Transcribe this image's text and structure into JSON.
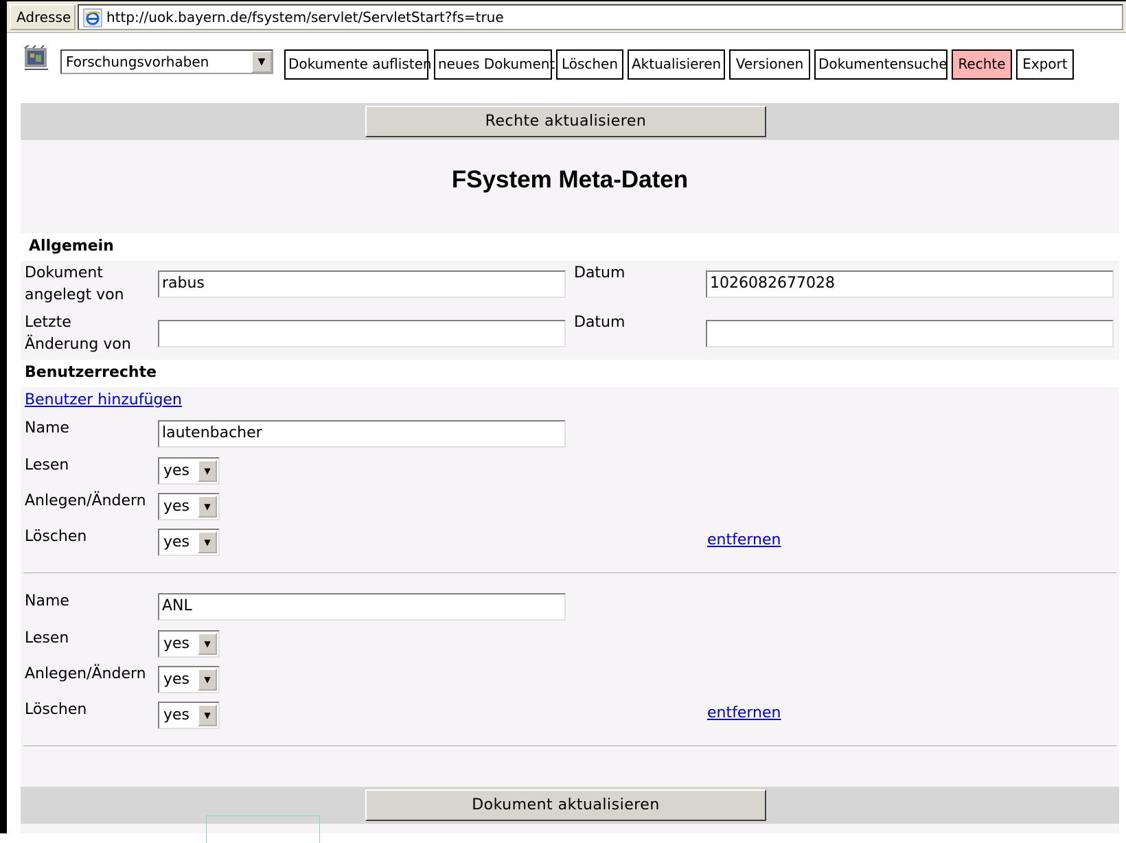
{
  "addressbar": {
    "label": "Adresse",
    "url": "http://uok.bayern.de/fsystem/servlet/ServletStart?fs=true"
  },
  "toolbar": {
    "doctype_selected": "Forschungsvorhaben",
    "buttons": [
      {
        "label": "Dokumente auflisten"
      },
      {
        "label": "neues Dokument"
      },
      {
        "label": "Löschen"
      },
      {
        "label": "Aktualisieren"
      },
      {
        "label": "Versionen"
      },
      {
        "label": "Dokumentensuche"
      },
      {
        "label": "Rechte",
        "color": "#ffb4b4"
      },
      {
        "label": "Export"
      }
    ]
  },
  "top_action": {
    "label": "Rechte aktualisieren"
  },
  "page_title": "FSystem Meta-Daten",
  "allgemein": {
    "heading": "Allgemein",
    "created_by_label_1": "Dokument",
    "created_by_label_2": "angelegt von",
    "created_by_value": "rabus",
    "date_label": "Datum",
    "created_date_value": "1026082677028",
    "modified_by_label_1": "Letzte",
    "modified_by_label_2": "Änderung von",
    "modified_by_value": "",
    "modified_date_label": "Datum",
    "modified_date_value": ""
  },
  "rights": {
    "heading": "Benutzerrechte",
    "add_user_link": "Benutzer hinzufügen",
    "entries": [
      {
        "name_label": "Name",
        "name_value": "lautenbacher",
        "read_label": "Lesen",
        "read_value": "yes",
        "edit_label": "Anlegen/Ändern",
        "edit_value": "yes",
        "delete_label": "Löschen",
        "delete_value": "yes",
        "remove_link": "entfernen"
      },
      {
        "name_label": "Name",
        "name_value": "ANL",
        "read_label": "Lesen",
        "read_value": "yes",
        "edit_label": "Anlegen/Ändern",
        "edit_value": "yes",
        "delete_label": "Löschen",
        "delete_value": "yes",
        "remove_link": "entfernen"
      }
    ]
  },
  "bottom_action": {
    "label": "Dokument aktualisieren"
  }
}
